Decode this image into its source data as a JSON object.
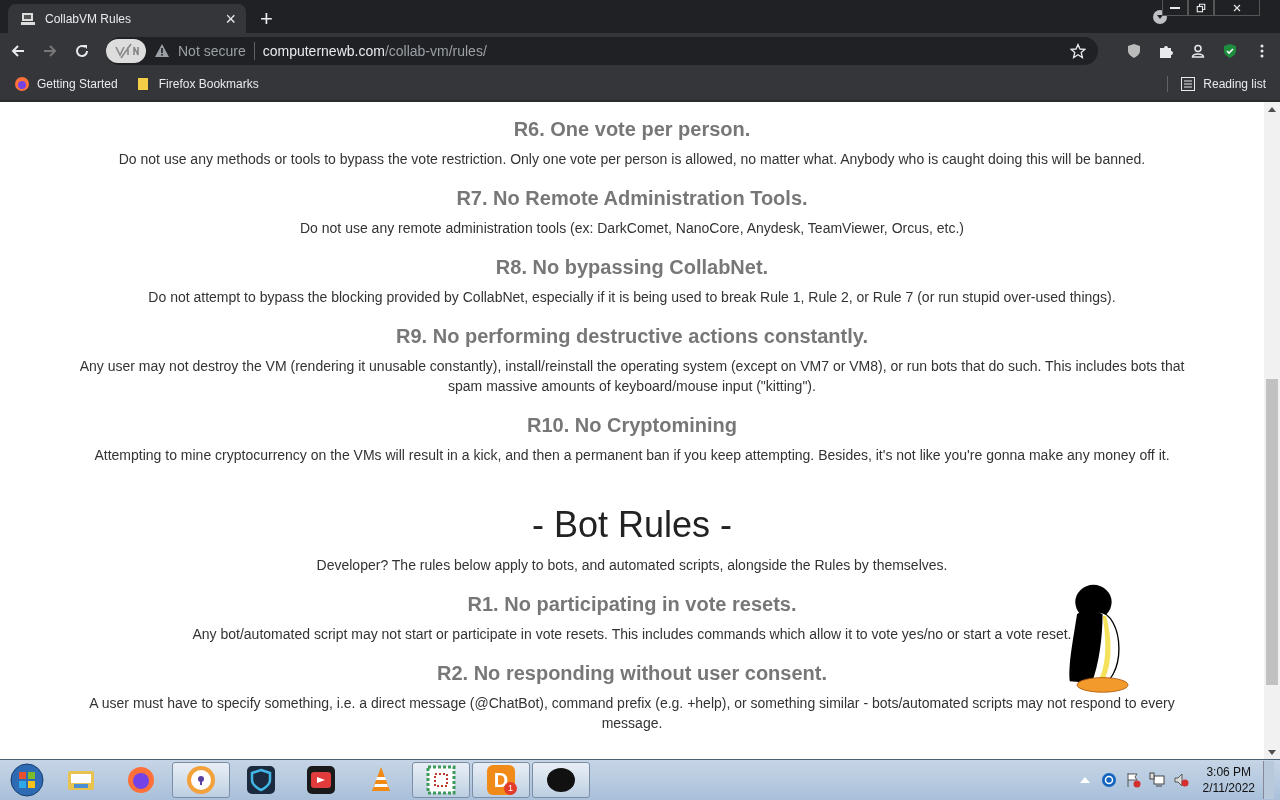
{
  "browser": {
    "tab": {
      "title": "CollabVM Rules",
      "close": "×"
    },
    "new_tab": "+",
    "address": {
      "security": "Not secure",
      "domain": "computernewb.com",
      "path": "/collab-vm/rules/"
    },
    "bookmarks": [
      {
        "kind": "firefox",
        "label": "Getting Started"
      },
      {
        "kind": "folder",
        "label": "Firefox Bookmarks"
      }
    ],
    "reading_list": "Reading list"
  },
  "rules": [
    {
      "heading": "R6. One vote per person.",
      "text": "Do not use any methods or tools to bypass the vote restriction. Only one vote per person is allowed, no matter what. Anybody who is caught doing this will be banned."
    },
    {
      "heading": "R7. No Remote Administration Tools.",
      "text": "Do not use any remote administration tools (ex: DarkComet, NanoCore, Anydesk, TeamViewer, Orcus, etc.)"
    },
    {
      "heading": "R8. No bypassing CollabNet.",
      "text": "Do not attempt to bypass the blocking provided by CollabNet, especially if it is being used to break Rule 1, Rule 2, or Rule 7 (or run stupid over-used things)."
    },
    {
      "heading": "R9. No performing destructive actions constantly.",
      "text": "Any user may not destroy the VM (rendering it unusable constantly), install/reinstall the operating system (except on VM7 or VM8), or run bots that do such. This includes bots that spam massive amounts of keyboard/mouse input (\"kitting\")."
    },
    {
      "heading": "R10. No Cryptomining",
      "text": "Attempting to mine cryptocurrency on the VMs will result in a kick, and then a permanent ban if you keep attempting. Besides, it's not like you're gonna make any money off it."
    }
  ],
  "bot_section": {
    "title": "- Bot Rules -",
    "intro": "Developer? The rules below apply to bots, and automated scripts, alongside the Rules by themselves.",
    "rules": [
      {
        "heading": "R1. No participating in vote resets.",
        "text": "Any bot/automated script may not start or participate in vote resets. This includes commands which allow it to vote yes/no or start a vote reset."
      },
      {
        "heading": "R2. No responding without user consent.",
        "text": "A user must have to specify something, i.e. a direct message (@ChatBot), command prefix (e.g. +help), or something similar - bots/automated scripts may not respond to every message."
      }
    ]
  },
  "taskbar": {
    "apps": [
      {
        "kind": "explorer",
        "running": false
      },
      {
        "kind": "firefox",
        "running": false
      },
      {
        "kind": "lock-browser",
        "running": true
      },
      {
        "kind": "shield",
        "running": false
      },
      {
        "kind": "recorder",
        "running": false
      },
      {
        "kind": "cone",
        "running": false
      },
      {
        "kind": "grid",
        "running": true
      },
      {
        "kind": "letter",
        "label": "D",
        "badge": "1",
        "running": true
      },
      {
        "kind": "penguin",
        "running": true
      }
    ],
    "clock": {
      "time": "3:06 PM",
      "date": "2/11/2022"
    }
  }
}
